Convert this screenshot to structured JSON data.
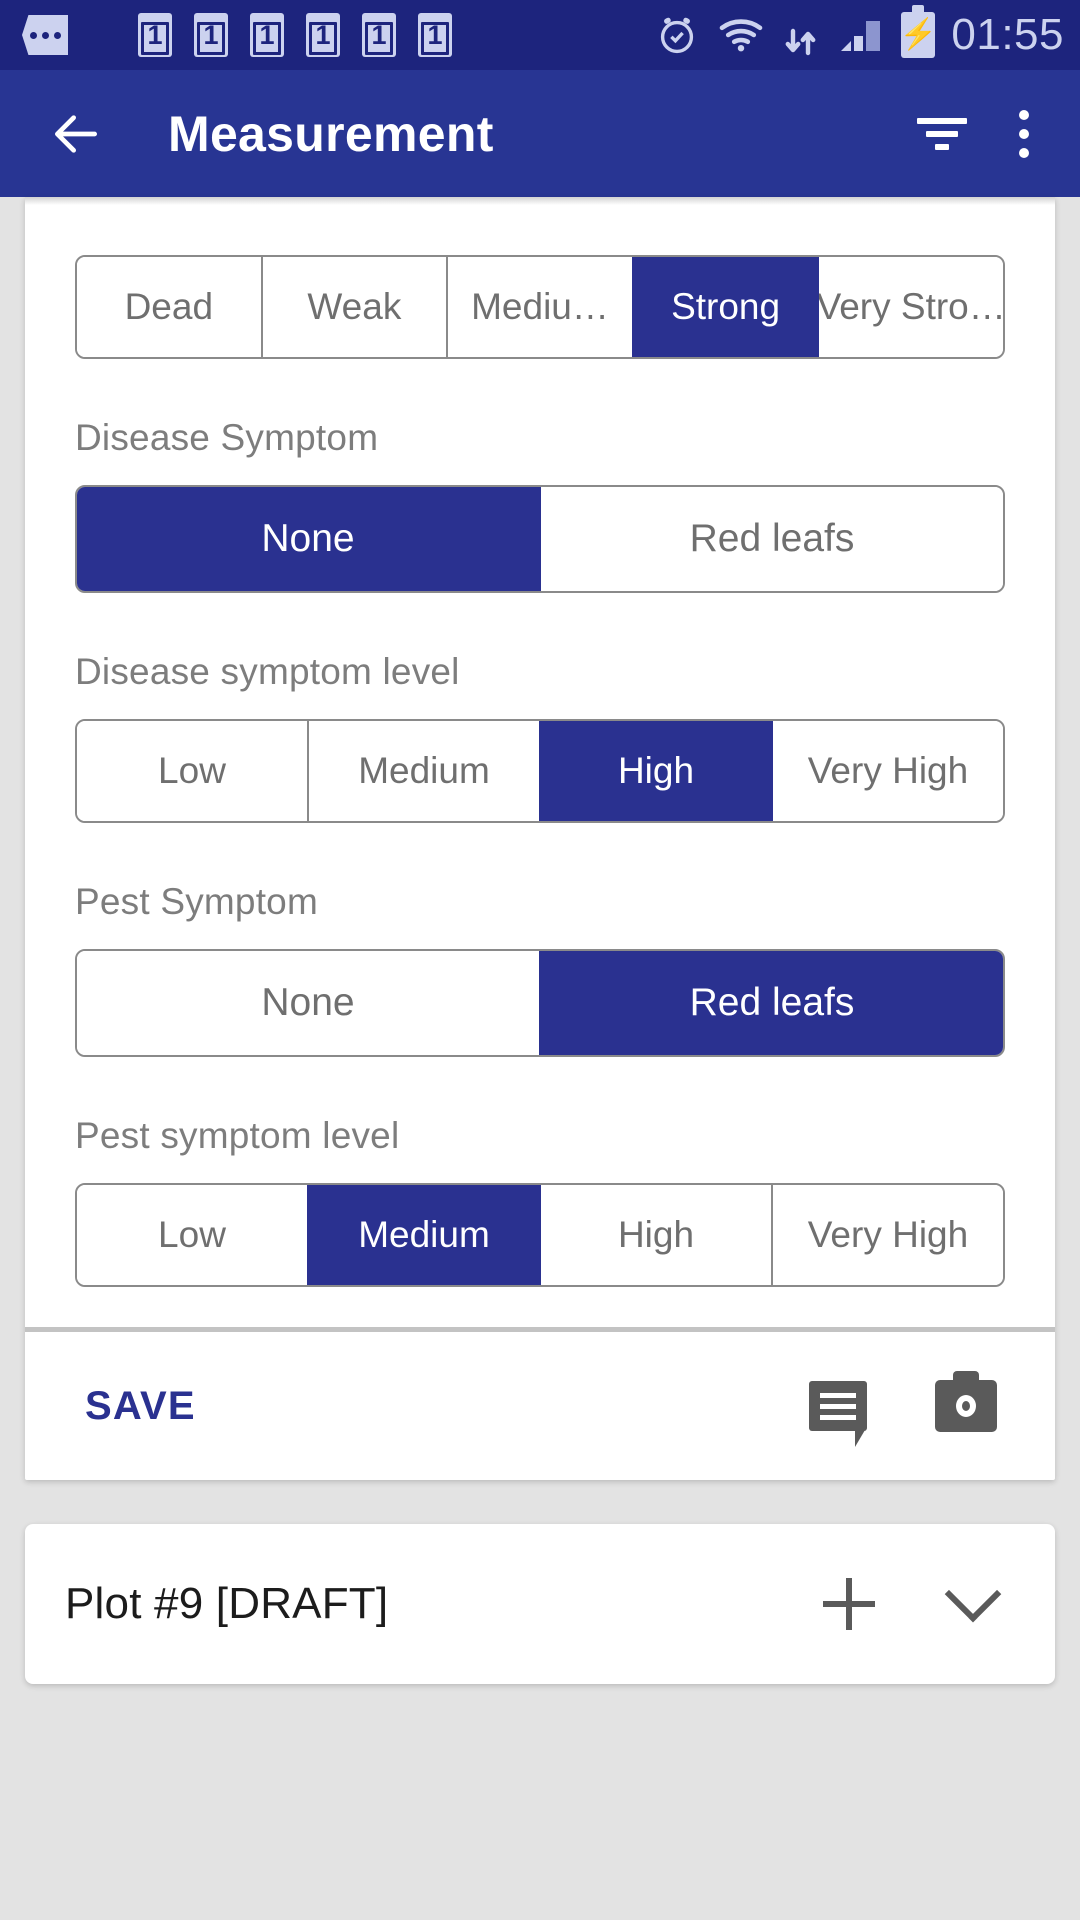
{
  "status_bar": {
    "time": "01:55",
    "sms_badges": [
      "1",
      "1",
      "1",
      "1",
      "1",
      "1"
    ],
    "icons": [
      "message-dots-icon",
      "alarm-icon",
      "wifi-icon",
      "data-transfer-icon",
      "signal-icon",
      "battery-charging-icon"
    ],
    "background_color": "#1d247d"
  },
  "app_bar": {
    "title": "Measurement",
    "back_icon": "arrow-left-icon",
    "filter_icon": "filter-icon",
    "overflow_icon": "more-vertical-icon",
    "background_color": "#283593"
  },
  "theme": {
    "accent": "#2a3190",
    "page_background": "#e3e3e3",
    "card_background": "#ffffff",
    "label_color": "#7d7d7d",
    "segment_text": "#6f6f6f"
  },
  "form": {
    "fields": [
      {
        "label": "",
        "name": "vigor-level",
        "options": [
          {
            "text": "Dead",
            "selected": false
          },
          {
            "text": "Weak",
            "selected": false
          },
          {
            "text": "Mediu…",
            "selected": false
          },
          {
            "text": "Strong",
            "selected": true
          },
          {
            "text": "Very Stro…",
            "selected": false
          }
        ]
      },
      {
        "label": "Disease Symptom",
        "name": "disease-symptom",
        "options": [
          {
            "text": "None",
            "selected": true
          },
          {
            "text": "Red leafs",
            "selected": false
          }
        ]
      },
      {
        "label": "Disease symptom level",
        "name": "disease-symptom-level",
        "options": [
          {
            "text": "Low",
            "selected": false
          },
          {
            "text": "Medium",
            "selected": false
          },
          {
            "text": "High",
            "selected": true
          },
          {
            "text": "Very High",
            "selected": false
          }
        ]
      },
      {
        "label": "Pest Symptom",
        "name": "pest-symptom",
        "options": [
          {
            "text": "None",
            "selected": false
          },
          {
            "text": "Red leafs",
            "selected": true
          }
        ]
      },
      {
        "label": "Pest symptom level",
        "name": "pest-symptom-level",
        "options": [
          {
            "text": "Low",
            "selected": false
          },
          {
            "text": "Medium",
            "selected": true
          },
          {
            "text": "High",
            "selected": false
          },
          {
            "text": "Very High",
            "selected": false
          }
        ]
      }
    ]
  },
  "save_row": {
    "save_label": "SAVE",
    "comment_icon": "comment-icon",
    "camera_icon": "camera-icon"
  },
  "plot_card": {
    "title": "Plot #9 [DRAFT]",
    "add_icon": "plus-icon",
    "expand_icon": "chevron-down-icon"
  }
}
